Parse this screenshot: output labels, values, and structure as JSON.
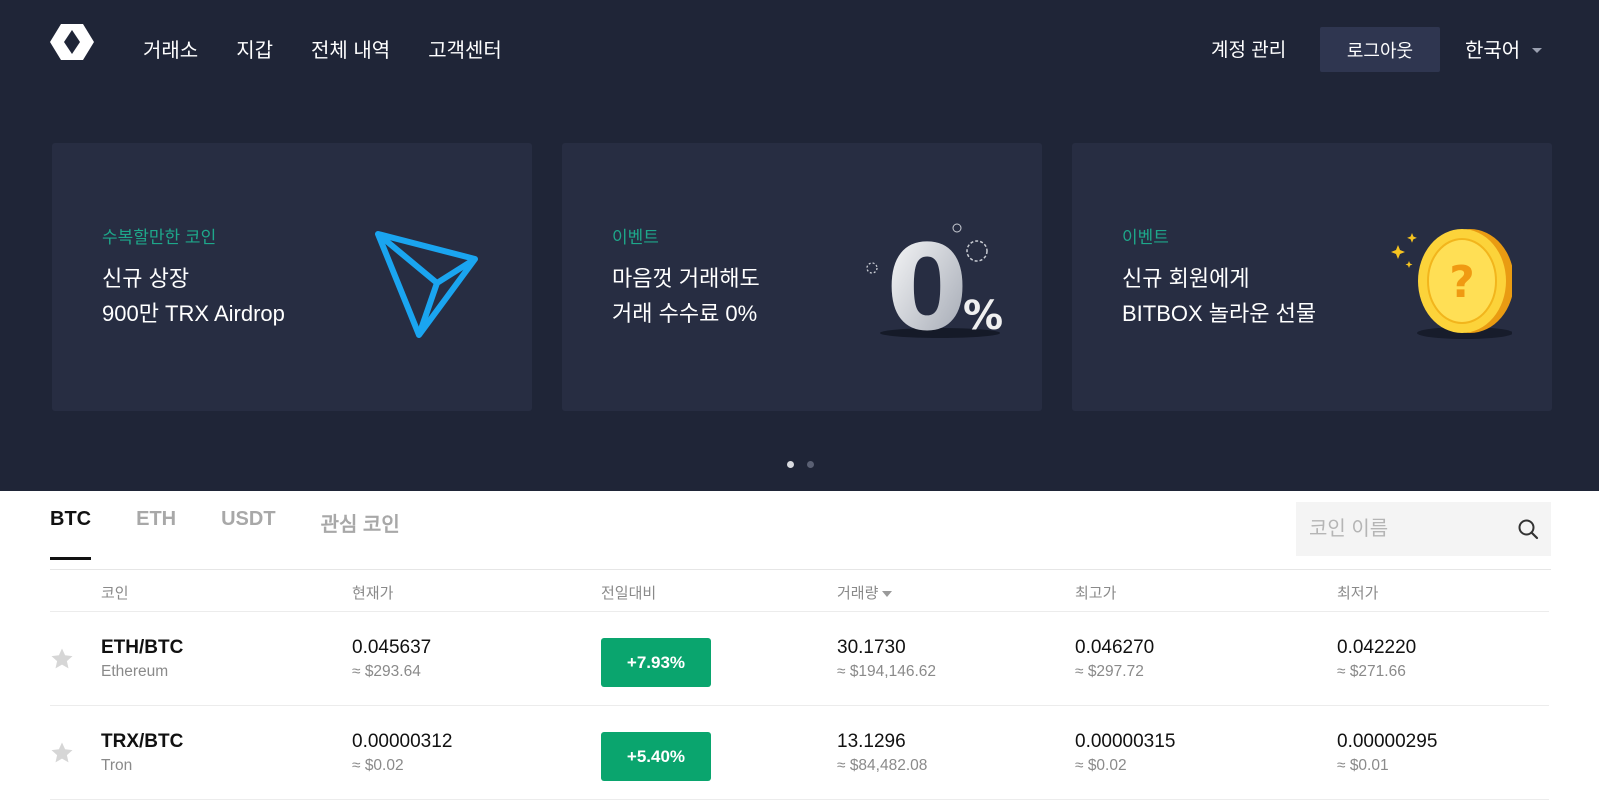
{
  "nav": {
    "items": [
      {
        "label": "거래소"
      },
      {
        "label": "지갑"
      },
      {
        "label": "전체 내역"
      },
      {
        "label": "고객센터"
      }
    ],
    "account": "계정 관리",
    "logout": "로그아웃",
    "language": "한국어"
  },
  "banners": [
    {
      "tag": "수복할만한 코인",
      "title": "신규 상장\n900만 TRX Airdrop",
      "icon": "tron-logo-icon"
    },
    {
      "tag": "이벤트",
      "title": "마음껏 거래해도\n거래 수수료 0%",
      "icon": "zero-percent-icon",
      "big_zero": "0",
      "percent": "%"
    },
    {
      "tag": "이벤트",
      "title": "신규 회원에게\nBITBOX 놀라운 선물",
      "icon": "gold-coin-question-icon",
      "coin_glyph": "?"
    }
  ],
  "carousel": {
    "pages": 2,
    "active": 0
  },
  "tabs": [
    {
      "label": "BTC",
      "active": true
    },
    {
      "label": "ETH",
      "active": false
    },
    {
      "label": "USDT",
      "active": false
    },
    {
      "label": "관심 코인",
      "active": false
    }
  ],
  "search": {
    "placeholder": "코인 이름"
  },
  "table": {
    "headers": {
      "coin": "코인",
      "price": "현재가",
      "change": "전일대비",
      "volume": "거래량",
      "high": "최고가",
      "low": "최저가"
    },
    "rows": [
      {
        "pair": "ETH/BTC",
        "name": "Ethereum",
        "price": "0.045637",
        "price_usd": "≈ $293.64",
        "change": "+7.93%",
        "volume": "30.1730",
        "volume_usd": "≈ $194,146.62",
        "high": "0.046270",
        "high_usd": "≈ $297.72",
        "low": "0.042220",
        "low_usd": "≈ $271.66"
      },
      {
        "pair": "TRX/BTC",
        "name": "Tron",
        "price": "0.00000312",
        "price_usd": "≈ $0.02",
        "change": "+5.40%",
        "volume": "13.1296",
        "volume_usd": "≈ $84,482.08",
        "high": "0.00000315",
        "high_usd": "≈ $0.02",
        "low": "0.00000295",
        "low_usd": "≈ $0.01"
      }
    ]
  },
  "colors": {
    "hero_bg": "#1f2537",
    "card_bg": "#272d42",
    "accent_teal": "#1ea78a",
    "positive_green": "#0aa56e"
  }
}
